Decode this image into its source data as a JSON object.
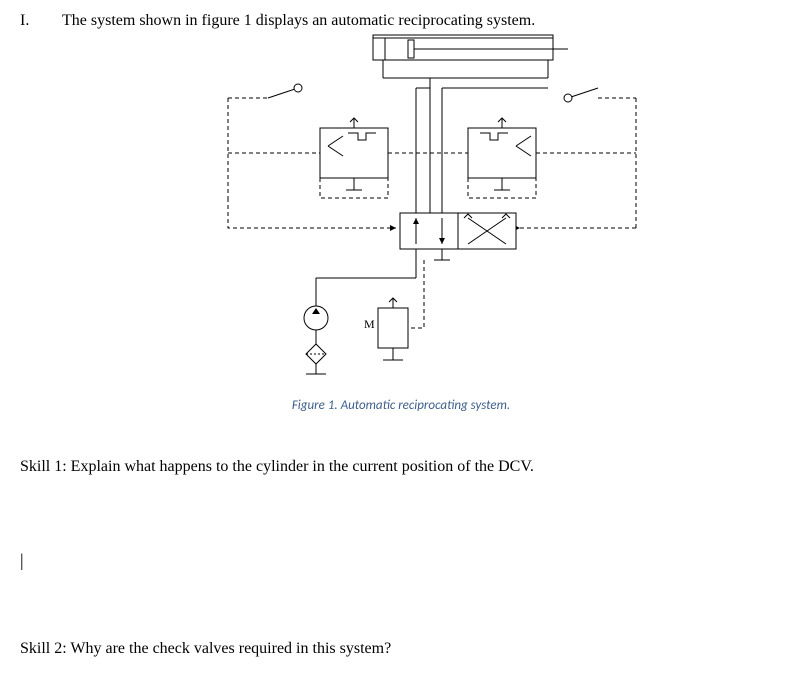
{
  "heading": {
    "marker": "I.",
    "text": "The system shown in figure 1 displays an automatic reciprocating system."
  },
  "figure": {
    "caption": "Figure 1. Automatic reciprocating system.",
    "label_m": "M",
    "components": {
      "cylinder": "double-acting-cylinder",
      "dcv": "4-3-dcv-pilot-operated",
      "check_valves": 2,
      "pilots": "cam-roller-pilots",
      "pump": "fixed-displacement-pump",
      "motor": "electric-motor",
      "tank": "reservoir"
    }
  },
  "skill1": "Skill 1: Explain what happens to the cylinder in the current position of the DCV.",
  "caret": "|",
  "skill2": "Skill 2: Why are the check valves required in this system?"
}
